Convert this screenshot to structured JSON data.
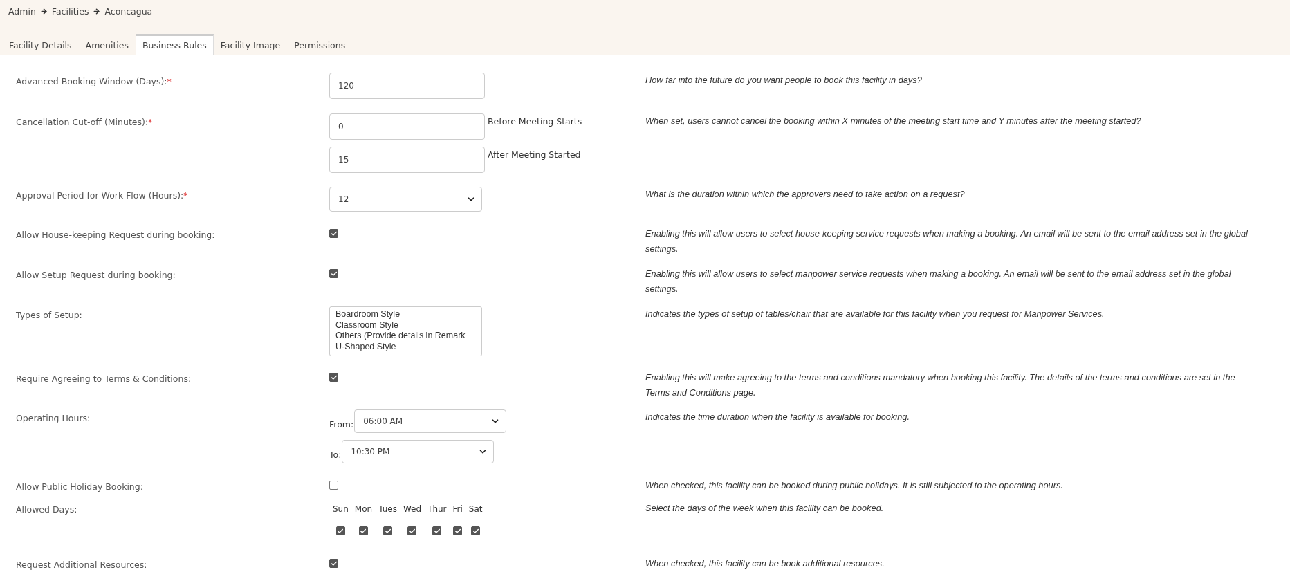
{
  "breadcrumb": [
    "Admin",
    "Facilities",
    "Aconcagua"
  ],
  "tabs": [
    {
      "label": "Facility Details",
      "selected": false
    },
    {
      "label": "Amenities",
      "selected": false
    },
    {
      "label": "Business Rules",
      "selected": true
    },
    {
      "label": "Facility Image",
      "selected": false
    },
    {
      "label": "Permissions",
      "selected": false
    }
  ],
  "rows": [
    {
      "kind": "text",
      "label": "Advanced Booking Window (Days):",
      "required_mark": "*",
      "value": "120",
      "help": "How far into the future do you want people to book this facility in days?"
    },
    {
      "kind": "text_pair",
      "label": "Cancellation Cut-off (Minutes):",
      "required_mark": "*",
      "fields": [
        {
          "value": "0",
          "suffix": "Before Meeting Starts"
        },
        {
          "value": "15",
          "suffix": "After Meeting Started"
        }
      ],
      "help": "When set, users cannot cancel the booking within X minutes of the meeting start time and Y minutes after the meeting started?"
    },
    {
      "kind": "select",
      "label": "Approval Period for Work Flow (Hours):",
      "required_mark": "*",
      "value": "12",
      "help": "What is the duration within which the approvers need to take action on a request?"
    },
    {
      "kind": "checkbox",
      "label": "Allow House-keeping Request during booking:",
      "checked": true,
      "help": "Enabling this will allow users to select house-keeping service requests when making a booking. An email will be sent to the email address set in the global settings."
    },
    {
      "kind": "checkbox",
      "label": "Allow Setup Request during booking:",
      "checked": true,
      "help": "Enabling this will allow users to select manpower service requests when making a booking. An email will be sent to the email address set in the global settings."
    },
    {
      "kind": "listbox",
      "label": "Types of Setup:",
      "options": [
        "Boardroom Style",
        "Classroom Style",
        "Others (Provide details in Remark",
        "U-Shaped Style"
      ],
      "help": "Indicates the types of setup of tables/chair that are available for this facility when you request for Manpower Services."
    },
    {
      "kind": "checkbox",
      "label": "Require Agreeing to Terms & Conditions:",
      "checked": true,
      "help": "Enabling this will make agreeing to the terms and conditions mandatory when booking this facility. The details of the terms and conditions are set in the Terms and Conditions page."
    },
    {
      "kind": "time_range",
      "label": "Operating Hours:",
      "times": [
        {
          "prefix": "From:",
          "value": "06:00 AM"
        },
        {
          "prefix": "To:",
          "value": "10:30 PM"
        }
      ],
      "help": "Indicates the time duration when the facility is available for booking."
    },
    {
      "kind": "checkbox",
      "label": "Allow Public Holiday Booking:",
      "checked": false,
      "help": "When checked, this facility can be booked during public holidays. It is still subjected to the operating hours."
    },
    {
      "kind": "days",
      "label": "Allowed Days:",
      "days": [
        {
          "label": "Sun",
          "checked": true
        },
        {
          "label": "Mon",
          "checked": true
        },
        {
          "label": "Tues",
          "checked": true
        },
        {
          "label": "Wed",
          "checked": true
        },
        {
          "label": "Thur",
          "checked": true
        },
        {
          "label": "Fri",
          "checked": true
        },
        {
          "label": "Sat",
          "checked": true
        }
      ],
      "help": "Select the days of the week when this facility can be booked."
    },
    {
      "kind": "checkbox",
      "label": "Request Additional Resources:",
      "checked": true,
      "help": "When checked, this facility can be book additional resources."
    }
  ]
}
